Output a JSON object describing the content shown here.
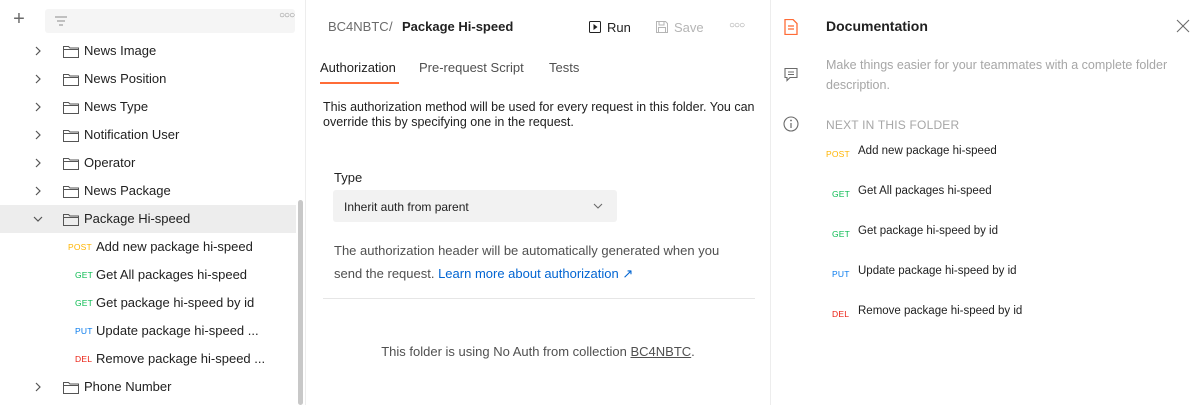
{
  "sidebar": {
    "add_icon": "plus-icon",
    "filter_icon": "filter-lines-icon",
    "more_icon": "more-horizontal-icon",
    "folders_top": [
      {
        "label": "News Image"
      },
      {
        "label": "News Position"
      },
      {
        "label": "News Type"
      },
      {
        "label": "Notification User"
      },
      {
        "label": "Operator"
      },
      {
        "label": "News Package"
      }
    ],
    "active_folder": {
      "label": "Package Hi-speed",
      "expanded": true
    },
    "requests": [
      {
        "method": "POST",
        "label": "Add new package hi-speed"
      },
      {
        "method": "GET",
        "label": "Get All packages hi-speed"
      },
      {
        "method": "GET",
        "label": "Get package hi-speed by id"
      },
      {
        "method": "PUT",
        "label": "Update package hi-speed ..."
      },
      {
        "method": "DEL",
        "label": "Remove package hi-speed ..."
      }
    ],
    "folders_bottom": [
      {
        "label": "Phone Number"
      }
    ]
  },
  "header": {
    "collection": "BC4NBTC",
    "separator": "/",
    "folder": "Package Hi-speed",
    "run_label": "Run",
    "save_label": "Save"
  },
  "tabs": [
    {
      "label": "Authorization",
      "active": true
    },
    {
      "label": "Pre-request Script",
      "active": false
    },
    {
      "label": "Tests",
      "active": false
    }
  ],
  "auth": {
    "description": "This authorization method will be used for every request in this folder. You can override this by specifying one in the request.",
    "type_label": "Type",
    "type_value": "Inherit auth from parent",
    "help_text": "The authorization header will be automatically generated when you send the request. ",
    "help_link": "Learn more about authorization ↗",
    "noauth_text": "This folder is using No Auth from collection ",
    "noauth_link": "BC4NBTC",
    "noauth_end": "."
  },
  "documentation": {
    "title": "Documentation",
    "description": "Make things easier for your teammates with a complete folder description.",
    "next_title": "NEXT IN THIS FOLDER",
    "items": [
      {
        "method": "POST",
        "label": "Add new package hi-speed"
      },
      {
        "method": "GET",
        "label": "Get All packages hi-speed"
      },
      {
        "method": "GET",
        "label": "Get package hi-speed by id"
      },
      {
        "method": "PUT",
        "label": "Update package hi-speed by id"
      },
      {
        "method": "DEL",
        "label": "Remove package hi-speed by id"
      }
    ]
  },
  "colors": {
    "accent": "#ff6c37",
    "post": "#ffb400",
    "get": "#0cbb52",
    "put": "#097bed",
    "del": "#eb2013",
    "link": "#0265d2"
  }
}
